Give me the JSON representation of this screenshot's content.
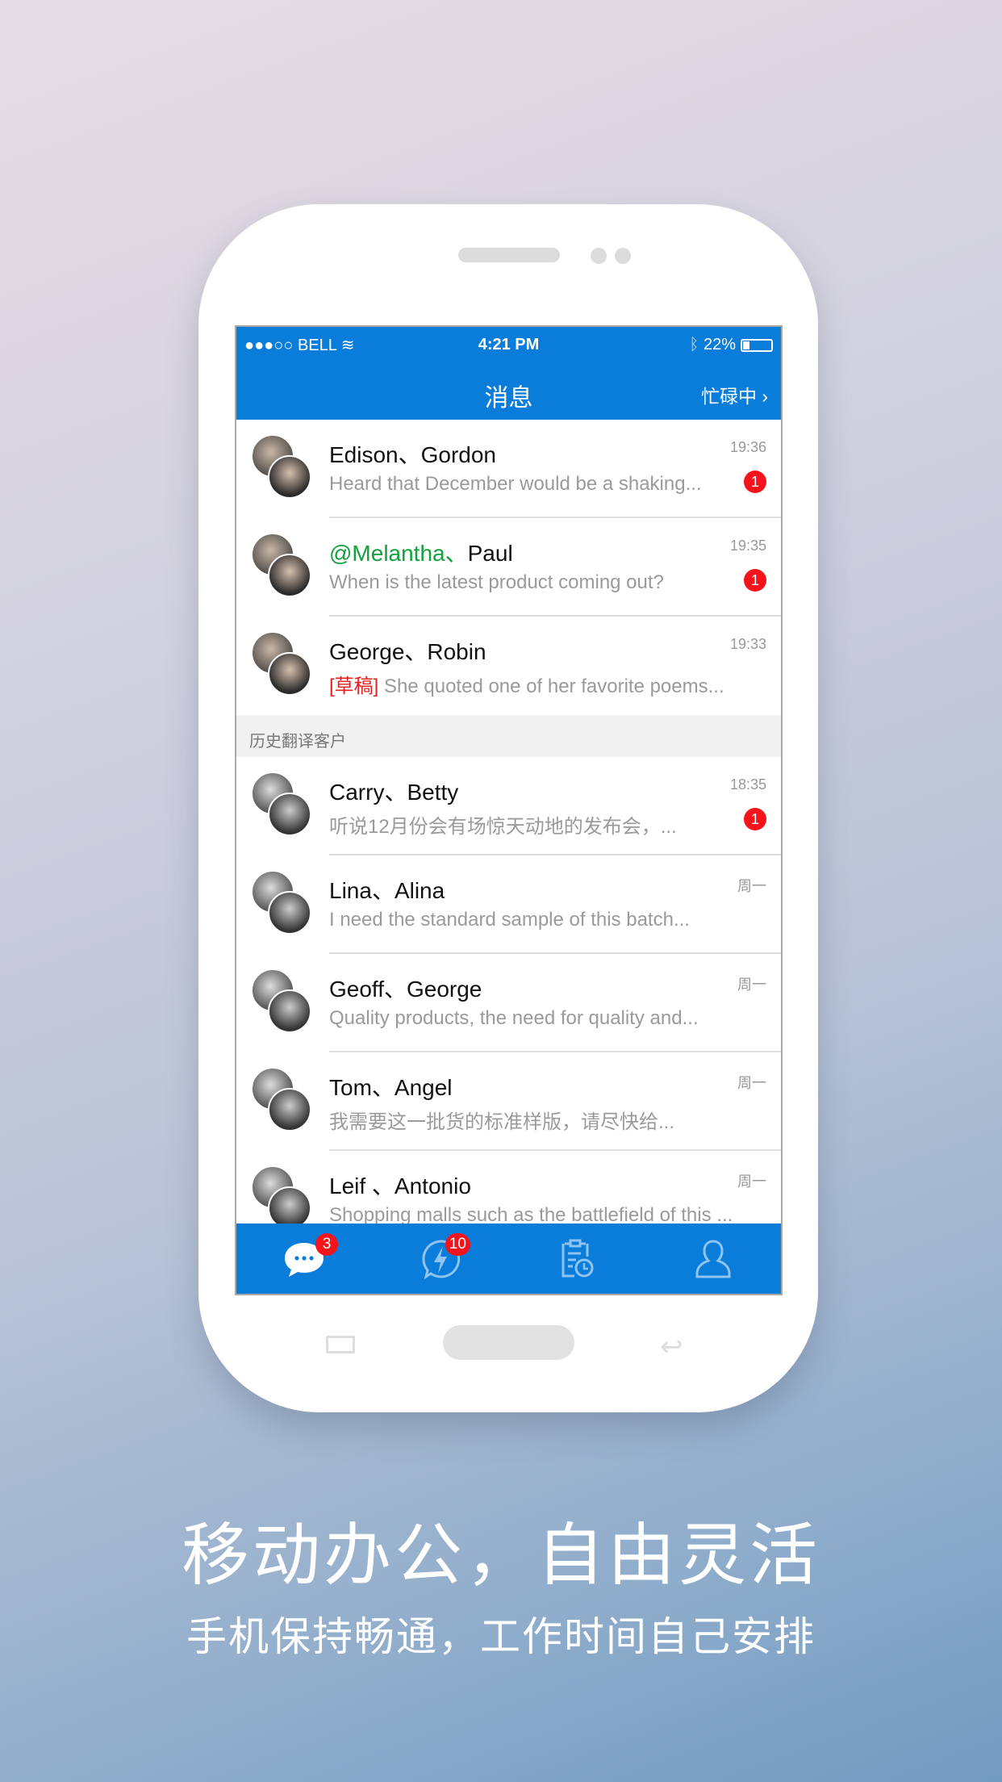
{
  "status": {
    "carrier": "●●●○○ BELL",
    "time": "4:21 PM",
    "battery": "22%"
  },
  "nav": {
    "title": "消息",
    "status_label": "忙碌中 ›"
  },
  "conversations": [
    {
      "name": "Edison、Gordon",
      "preview": "Heard that December would be a shaking...",
      "time": "19:36",
      "unread": "1"
    },
    {
      "mention": "@Melantha、",
      "name": "Paul",
      "preview": "When is the latest product coming out?",
      "time": "19:35",
      "unread": "1"
    },
    {
      "name": "George、Robin",
      "draft": "[草稿]",
      "preview": " She quoted one of her favorite poems...",
      "time": "19:33"
    }
  ],
  "section_title": "历史翻译客户",
  "history": [
    {
      "name": "Carry、Betty",
      "preview": "听说12月份会有场惊天动地的发布会，...",
      "time": "18:35",
      "unread": "1"
    },
    {
      "name": "Lina、Alina",
      "preview": "I need the standard sample of this batch...",
      "time": "周一"
    },
    {
      "name": "Geoff、George",
      "preview": "Quality products, the need for quality and...",
      "time": "周一"
    },
    {
      "name": "Tom、Angel",
      "preview": "我需要这一批货的标准样版，请尽快给...",
      "time": "周一"
    },
    {
      "name": "Leif 、Antonio",
      "preview": "Shopping malls such as the battlefield of this ...",
      "time": "周一"
    }
  ],
  "tabs": [
    {
      "icon": "chat-icon",
      "badge": "3"
    },
    {
      "icon": "lightning-icon",
      "badge": "10"
    },
    {
      "icon": "clipboard-clock-icon"
    },
    {
      "icon": "user-icon"
    }
  ],
  "headline": "移动办公，自由灵活",
  "subheadline": "手机保持畅通，工作时间自己安排",
  "colors": {
    "primary": "#0a7ddb",
    "badge": "#f5141b",
    "mention": "#13a13b",
    "draft": "#e42020"
  }
}
